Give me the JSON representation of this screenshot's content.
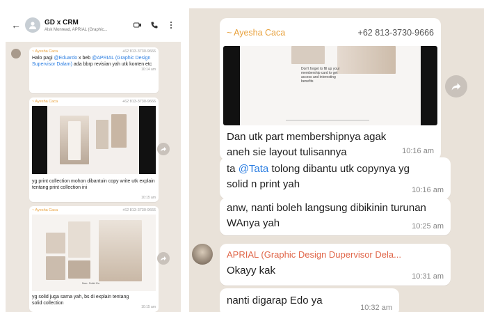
{
  "left": {
    "header": {
      "back_glyph": "←",
      "title": "GD x CRM",
      "subtitle": "Alsk Monread, APRIAL (Graphic...",
      "icons": [
        "video-call-icon",
        "phone-icon",
        "more-vertical-icon"
      ]
    },
    "messages": [
      {
        "sender": "~ Ayesha Caca",
        "phone": "+62 813-3730-9666",
        "text_before": "Halo pagi ",
        "mention1": "@Eduardo",
        "text_mid": " x beb ",
        "mention2": "@APRIAL (Graphic Design Supervisor Dalam)",
        "text_after": " ada bbrp revisian yah utk konten etc",
        "time": "10:14 am"
      },
      {
        "sender": "~ Ayesha Caca",
        "phone": "+62 813-3730-9666",
        "text": "yg print collection mohon dibantuin copy write utk explain tentang print collection ini",
        "time": "10:15 am"
      },
      {
        "sender": "~ Ayesha Caca",
        "phone": "+62 813-3730-9666",
        "image_caption": "Non- Solid Go",
        "text": "yg solid juga sama yah, bs di explain tentang solid collection",
        "time": "10:15 am"
      }
    ]
  },
  "right": {
    "messages": [
      {
        "sender": "~ Ayesha Caca",
        "phone": "+62 813-3730-9666",
        "image_caption": "Don't forget to fill up your membership card to get access and interesting benefits",
        "text": "Dan utk part membershipnya agak aneh sie layout tulisannya",
        "time": "10:16 am"
      },
      {
        "text_before": "ta ",
        "mention": "@Tata",
        "text_after": " tolong dibantu utk copynya yg solid n print yah",
        "time": "10:16 am"
      },
      {
        "text": "anw, nanti boleh langsung dibikinin turunan WAnya yah",
        "time": "10:25 am"
      },
      {
        "sender": "APRIAL (Graphic Design Dupervisor Dela...",
        "text": "Okayy kak",
        "time": "10:31 am"
      },
      {
        "text": "nanti digarap Edo ya",
        "time": "10:32 am"
      }
    ]
  },
  "colors": {
    "chat_bg": "#e9e2d9",
    "bubble": "#ffffff",
    "sender_orange": "#e8a13c",
    "sender_red": "#e0674a",
    "mention_blue": "#2a7de1"
  }
}
